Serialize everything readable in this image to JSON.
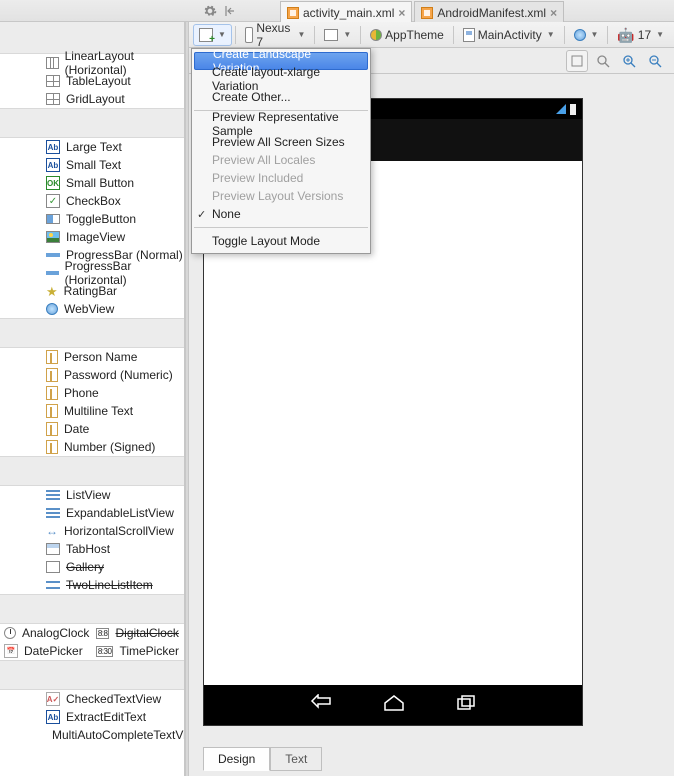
{
  "tabs": {
    "file1": "activity_main.xml",
    "file2": "AndroidManifest.xml"
  },
  "toolbar": {
    "device": "Nexus 7",
    "theme": "AppTheme",
    "activity": "MainActivity",
    "api": "17"
  },
  "dropdown": {
    "items": [
      "Create Landscape Variation",
      "Create layout-xlarge Variation",
      "Create Other...",
      "Preview Representative Sample",
      "Preview All Screen Sizes",
      "Preview All Locales",
      "Preview Included",
      "Preview Layout Versions",
      "None",
      "Toggle Layout Mode"
    ]
  },
  "palette": {
    "g1": [
      "LinearLayout (Horizontal)",
      "TableLayout",
      "GridLayout"
    ],
    "g2": [
      "Large Text",
      "Small Text",
      "Small Button",
      "CheckBox",
      "ToggleButton",
      "ImageView",
      "ProgressBar (Normal)",
      "ProgressBar (Horizontal)",
      "RatingBar",
      "WebView"
    ],
    "g3": [
      "Person Name",
      "Password (Numeric)",
      "Phone",
      "Multiline Text",
      "Date",
      "Number (Signed)"
    ],
    "g4": [
      "ListView",
      "ExpandableListView",
      "HorizontalScrollView",
      "TabHost",
      "Gallery",
      "TwoLineListItem"
    ],
    "g5a": [
      "AnalogClock",
      "DatePicker"
    ],
    "g5b": [
      "DigitalClock",
      "TimePicker"
    ],
    "g6": [
      "CheckedTextView",
      "ExtractEditText",
      "MultiAutoCompleteTextView"
    ]
  },
  "bottom_tabs": {
    "design": "Design",
    "text": "Text"
  }
}
